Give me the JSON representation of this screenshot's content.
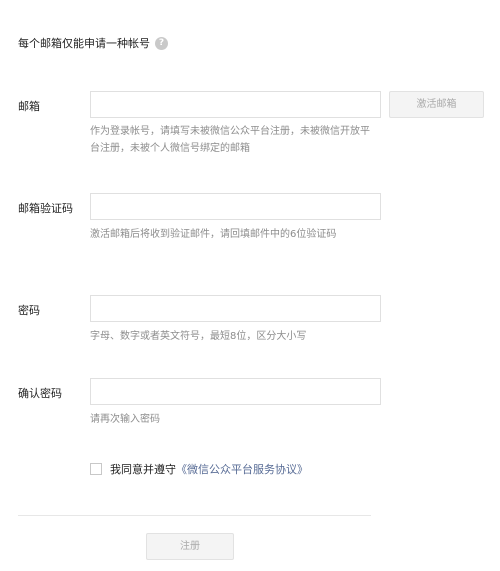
{
  "notice": {
    "text": "每个邮箱仅能申请一种帐号",
    "icon": "question-icon"
  },
  "email": {
    "label": "邮箱",
    "value": "",
    "hint": "作为登录帐号，请填写未被微信公众平台注册，未被微信开放平台注册，未被个人微信号绑定的邮箱",
    "activate_button": "激活邮箱"
  },
  "code": {
    "label": "邮箱验证码",
    "value": "",
    "hint": "激活邮箱后将收到验证邮件，请回填邮件中的6位验证码"
  },
  "password": {
    "label": "密码",
    "value": "",
    "hint": "字母、数字或者英文符号，最短8位，区分大小写"
  },
  "confirm": {
    "label": "确认密码",
    "value": "",
    "hint": "请再次输入密码"
  },
  "agreement": {
    "checked": false,
    "text": "我同意并遵守",
    "link": "《微信公众平台服务协议》"
  },
  "submit_label": "注册"
}
